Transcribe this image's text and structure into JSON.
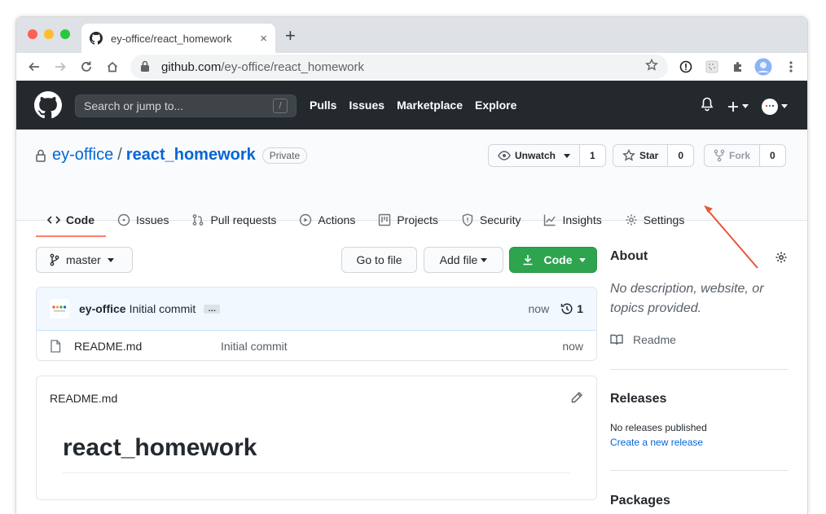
{
  "browser": {
    "tab_title": "ey-office/react_homework",
    "tab_close": "×",
    "new_tab": "+",
    "url_host": "github.com",
    "url_path": "/ey-office/react_homework"
  },
  "header": {
    "search_placeholder": "Search or jump to...",
    "search_shortcut": "/",
    "nav": [
      "Pulls",
      "Issues",
      "Marketplace",
      "Explore"
    ]
  },
  "repo": {
    "owner": "ey-office",
    "separator": "/",
    "name": "react_homework",
    "visibility": "Private",
    "unwatch_label": "Unwatch",
    "watch_count": "1",
    "star_label": "Star",
    "star_count": "0",
    "fork_label": "Fork",
    "fork_count": "0"
  },
  "tabs": [
    "Code",
    "Issues",
    "Pull requests",
    "Actions",
    "Projects",
    "Security",
    "Insights",
    "Settings"
  ],
  "main": {
    "branch": "master",
    "go_to_file": "Go to file",
    "add_file": "Add file",
    "code_button": "Code",
    "commit": {
      "author": "ey-office",
      "message": "Initial commit",
      "ellipsis": "…",
      "when": "now",
      "history_count": "1"
    },
    "files": [
      {
        "name": "README.md",
        "message": "Initial commit",
        "when": "now"
      }
    ],
    "readme": {
      "filename": "README.md",
      "heading": "react_homework"
    }
  },
  "sidebar": {
    "about_title": "About",
    "about_desc": "No description, website, or topics provided.",
    "readme_link": "Readme",
    "releases_title": "Releases",
    "no_releases": "No releases published",
    "create_release": "Create a new release",
    "packages_title": "Packages"
  },
  "colors": {
    "header_bg": "#24292e",
    "link_blue": "#0366d6",
    "green_button": "#2ea44f",
    "active_tab_underline": "#f9826c",
    "annotation_arrow": "#e8553e"
  }
}
